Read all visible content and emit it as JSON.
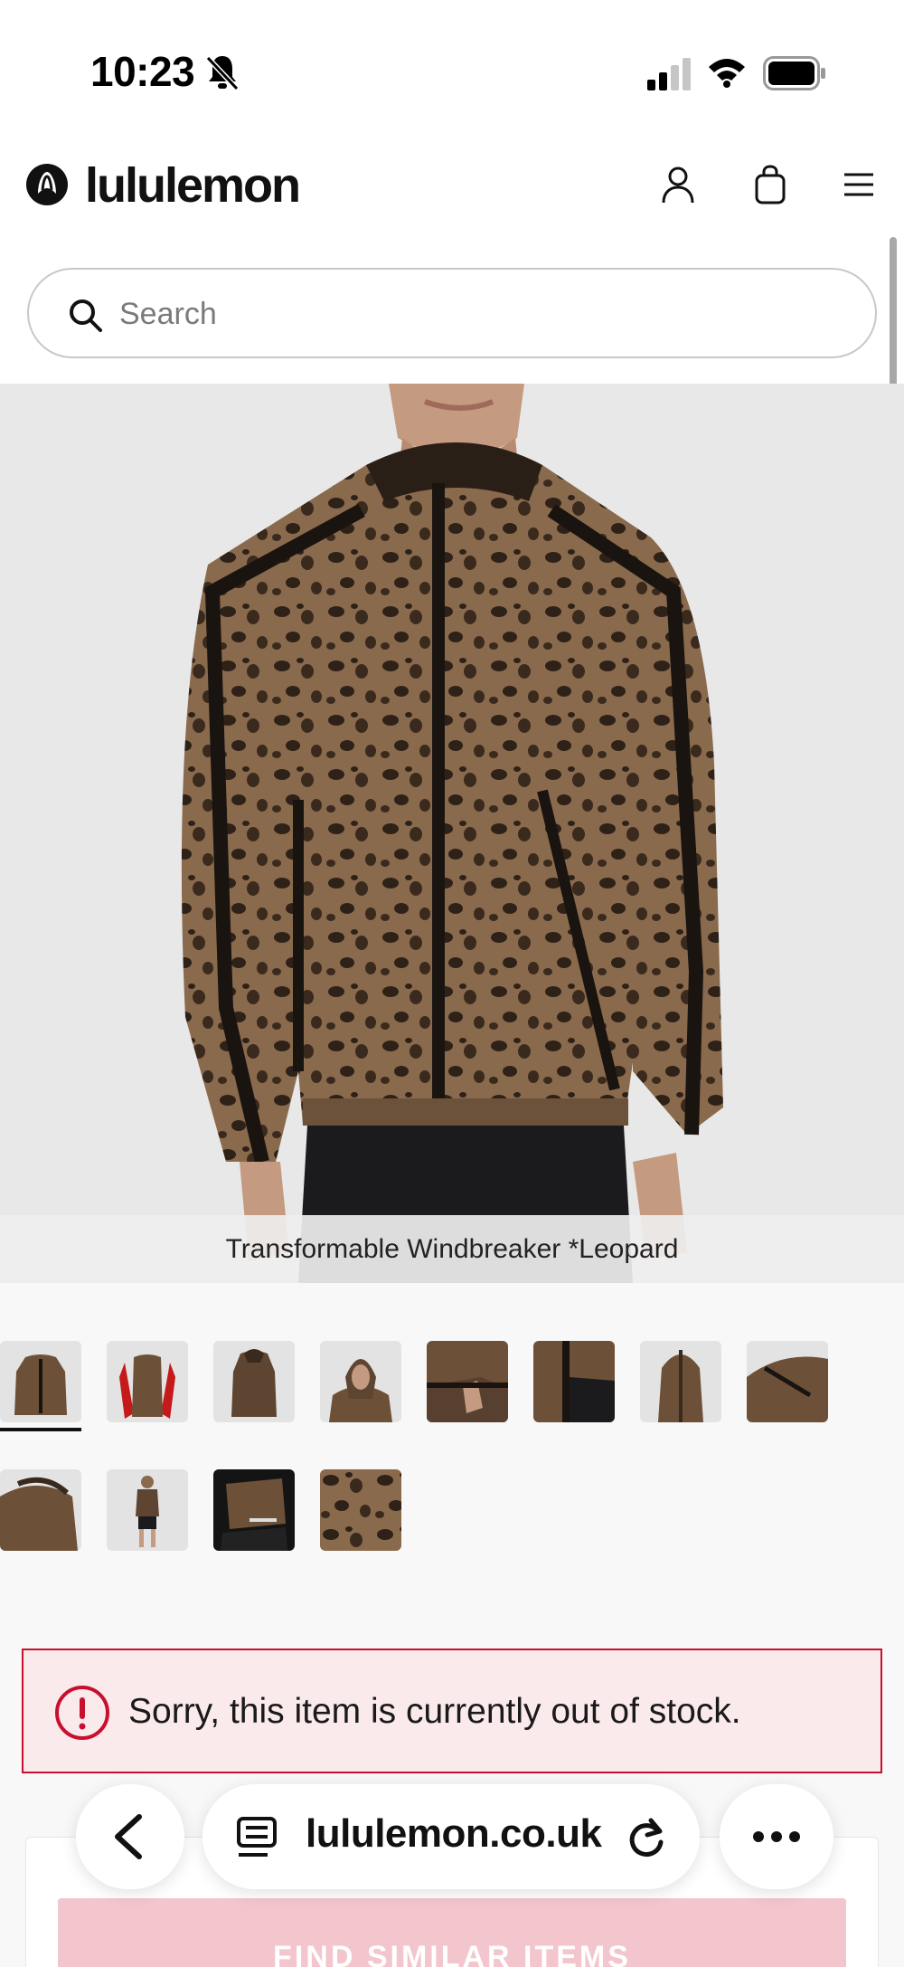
{
  "status_bar": {
    "time": "10:23"
  },
  "header": {
    "brand": "lululemon"
  },
  "search": {
    "placeholder": "Search",
    "value": ""
  },
  "product": {
    "caption": "Transformable Windbreaker *Leopard",
    "thumbnail_count": 12,
    "selected_thumbnail": 1
  },
  "alert": {
    "message": "Sorry, this item is currently out of stock."
  },
  "cta": {
    "label": "FIND SIMILAR ITEMS"
  },
  "browser": {
    "url": "lululemon.co.uk"
  },
  "colors": {
    "brand_red": "#c8102e",
    "alert_bg": "#fbeaec",
    "cta_bg": "#f3c5cc"
  }
}
